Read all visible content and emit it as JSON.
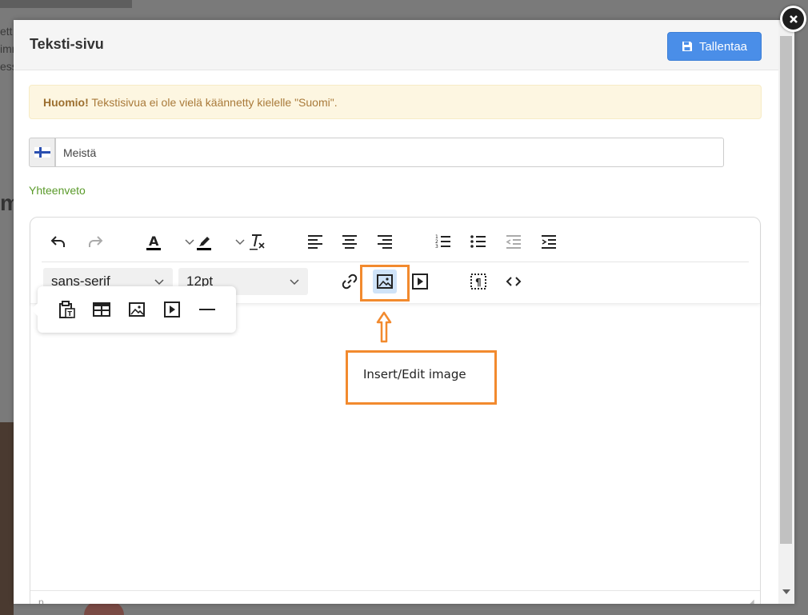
{
  "modal": {
    "title": "Teksti-sivu",
    "save_label": "Tallentaa"
  },
  "alert": {
    "strong": "Huomio!",
    "text": " Tekstisivua ei ole vielä käännetty kielelle \"Suomi\"."
  },
  "title_field": {
    "value": "Meistä",
    "flag": "finland-flag-icon"
  },
  "summary": {
    "label": "Yhteenveto"
  },
  "toolbar": {
    "row1_icons": [
      "undo-icon",
      "redo-icon",
      "text-color-icon",
      "chevron-down-icon",
      "highlight-icon",
      "chevron-down-icon",
      "clear-format-icon",
      "align-left-icon",
      "align-center-icon",
      "align-right-icon",
      "numbered-list-icon",
      "bullet-list-icon",
      "outdent-icon",
      "indent-icon"
    ],
    "font_family": "sans-serif",
    "font_size": "12pt",
    "row2_icons": [
      "link-icon",
      "image-icon",
      "media-icon",
      "show-blocks-icon",
      "source-code-icon"
    ]
  },
  "quickbar": {
    "icons": [
      "paste-text-icon",
      "table-icon",
      "image-icon",
      "media-icon",
      "horizontal-rule-icon"
    ]
  },
  "statusbar": {
    "path": "p"
  },
  "annotation": {
    "tooltip": "Insert/Edit image",
    "color": "#f28a2e"
  },
  "background": {
    "text_lines": [
      "ett",
      "imm",
      "ess"
    ],
    "big_text": "m"
  }
}
